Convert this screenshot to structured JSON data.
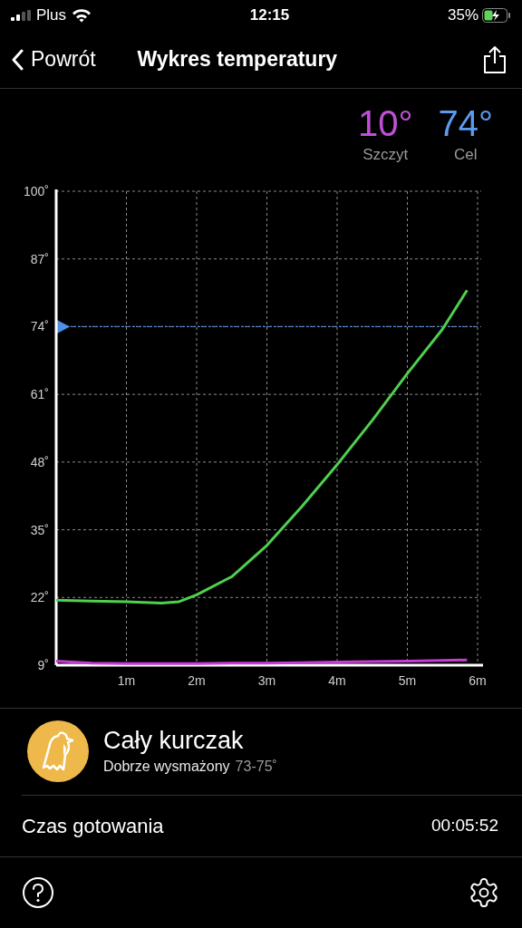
{
  "status_bar": {
    "carrier": "Plus",
    "time": "12:15",
    "battery": "35%",
    "charging": true
  },
  "nav": {
    "back": "Powrót",
    "title": "Wykres temperatury"
  },
  "readings": [
    {
      "value": "10°",
      "label": "Szczyt",
      "color": "#c04fd6"
    },
    {
      "value": "74°",
      "label": "Cel",
      "color": "#5b9cf0"
    }
  ],
  "chart_data": {
    "type": "line",
    "xlim": [
      0,
      6
    ],
    "ylim": [
      9,
      100
    ],
    "xticks": [
      {
        "value": 1,
        "label": "1m"
      },
      {
        "value": 2,
        "label": "2m"
      },
      {
        "value": 3,
        "label": "3m"
      },
      {
        "value": 4,
        "label": "4m"
      },
      {
        "value": 5,
        "label": "5m"
      },
      {
        "value": 6,
        "label": "6m"
      }
    ],
    "yticks": [
      {
        "value": 9,
        "label": "9˚"
      },
      {
        "value": 22,
        "label": "22˚"
      },
      {
        "value": 35,
        "label": "35˚"
      },
      {
        "value": 48,
        "label": "48˚"
      },
      {
        "value": 61,
        "label": "61˚"
      },
      {
        "value": 74,
        "label": "74˚"
      },
      {
        "value": 87,
        "label": "87˚"
      },
      {
        "value": 100,
        "label": "100˚"
      }
    ],
    "x": [
      0,
      0.5,
      1,
      1.5,
      1.75,
      2,
      2.5,
      3,
      3.5,
      4,
      4.5,
      5,
      5.5,
      5.85
    ],
    "series": [
      {
        "color": "#4fd04f",
        "values": [
          21.5,
          21.3,
          21.2,
          20.9,
          21.2,
          22.5,
          26,
          32,
          39.5,
          47.5,
          56,
          65,
          73.5,
          81
        ]
      },
      {
        "color": "#c73bd6",
        "values": [
          9.8,
          9.4,
          9.3,
          9.3,
          9.3,
          9.3,
          9.4,
          9.4,
          9.5,
          9.6,
          9.7,
          9.8,
          9.9,
          10
        ]
      }
    ],
    "grid": true,
    "ref_lines": [
      {
        "axis": "y",
        "value": 74,
        "color": "#4f8fea"
      }
    ]
  },
  "food": {
    "name": "Cały kurczak",
    "doneness": "Dobrze wysmażony",
    "range": "73-75˚"
  },
  "cooking_time": {
    "label": "Czas gotowania",
    "value": "00:05:52"
  }
}
